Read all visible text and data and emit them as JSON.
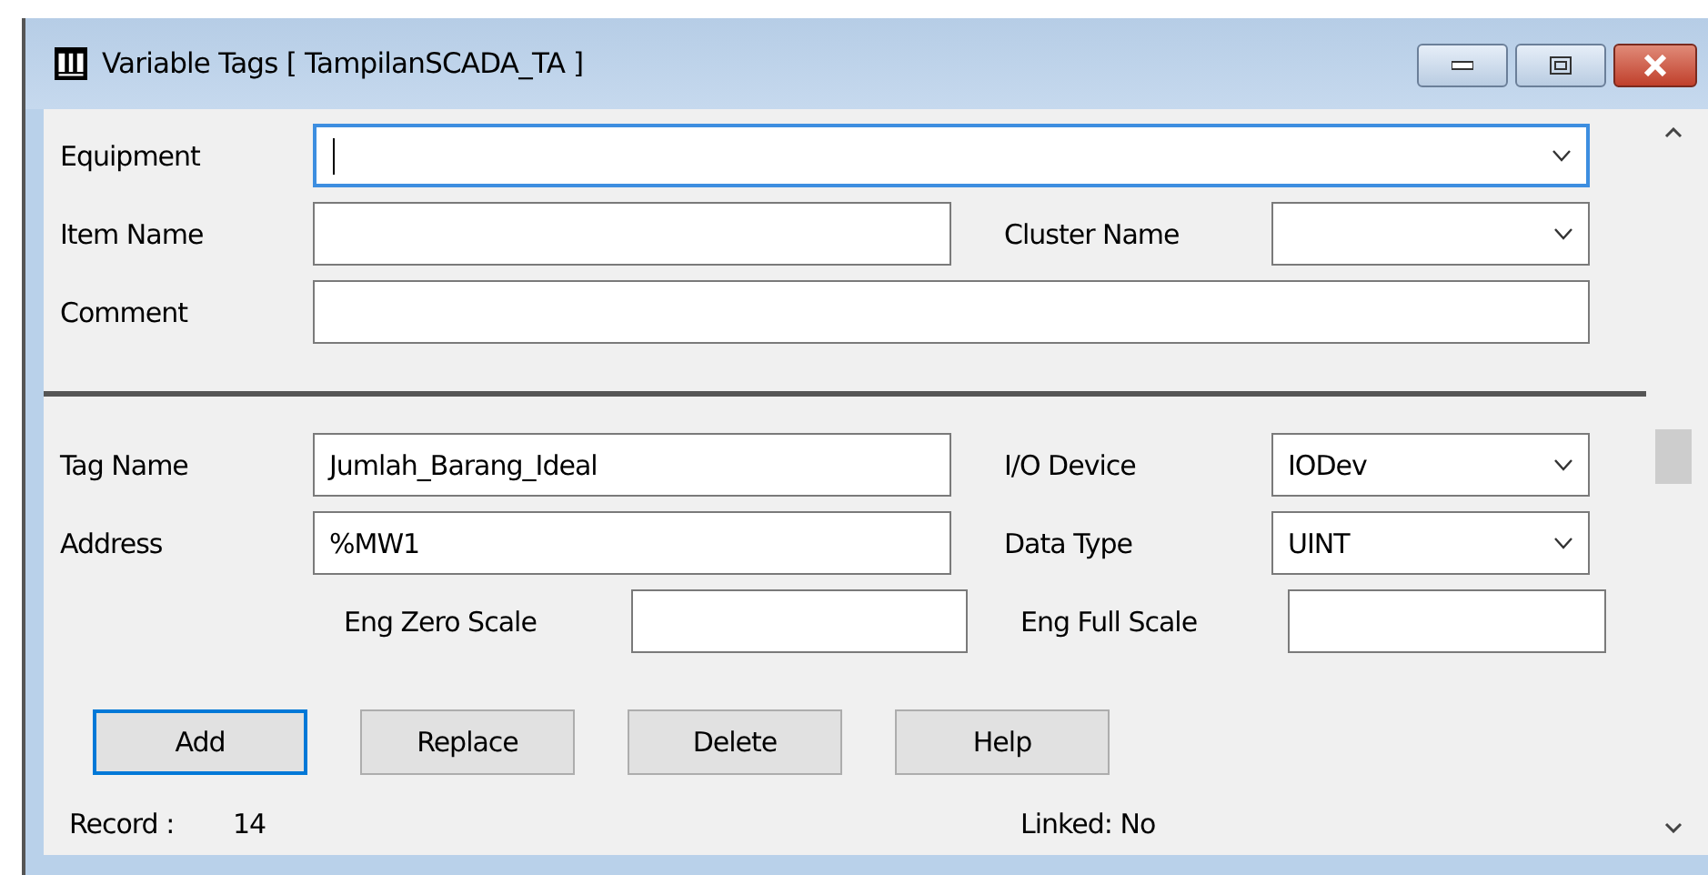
{
  "window": {
    "title": "Variable Tags [ TampilanSCADA_TA ]"
  },
  "sections": [
    {
      "rows": [
        {
          "items": [
            {
              "kind": "label",
              "text": "Equipment"
            },
            {
              "kind": "wide_combo",
              "value": "",
              "focused": true
            }
          ]
        },
        {
          "items": [
            {
              "kind": "label",
              "text": "Item Name"
            },
            {
              "kind": "text",
              "value": "",
              "focused": false
            },
            {
              "kind": "label",
              "text": "Cluster Name"
            },
            {
              "kind": "combo",
              "value": "",
              "focused": false
            }
          ]
        },
        {
          "items": [
            {
              "kind": "label",
              "text": "Comment"
            },
            {
              "kind": "wide_text",
              "value": "",
              "focused": false
            }
          ]
        }
      ]
    },
    {
      "rows": [
        {
          "items": [
            {
              "kind": "label",
              "text": "Tag Name"
            },
            {
              "kind": "text",
              "value": "Jumlah_Barang_Ideal",
              "focused": false
            },
            {
              "kind": "label",
              "text": "I/O Device"
            },
            {
              "kind": "combo",
              "value": "IODev",
              "focused": false
            }
          ]
        },
        {
          "items": [
            {
              "kind": "label",
              "text": "Address"
            },
            {
              "kind": "text",
              "value": "%MW1",
              "focused": false
            },
            {
              "kind": "label",
              "text": "Data Type"
            },
            {
              "kind": "combo",
              "value": "UINT",
              "focused": false
            }
          ]
        },
        {
          "items": [
            {
              "kind": "sublabel",
              "text": "Eng Zero Scale"
            },
            {
              "kind": "short",
              "value": "",
              "focused": false
            },
            {
              "kind": "label",
              "text": "Eng Full Scale"
            },
            {
              "kind": "narrow",
              "value": "",
              "focused": false
            }
          ]
        }
      ]
    }
  ],
  "buttons": [
    {
      "label": "Add",
      "selected": true
    },
    {
      "label": "Replace",
      "selected": false
    },
    {
      "label": "Delete",
      "selected": false
    },
    {
      "label": "Help",
      "selected": false
    }
  ],
  "status": {
    "record_label": "Record :",
    "record_value": "14",
    "linked": "Linked: No"
  }
}
